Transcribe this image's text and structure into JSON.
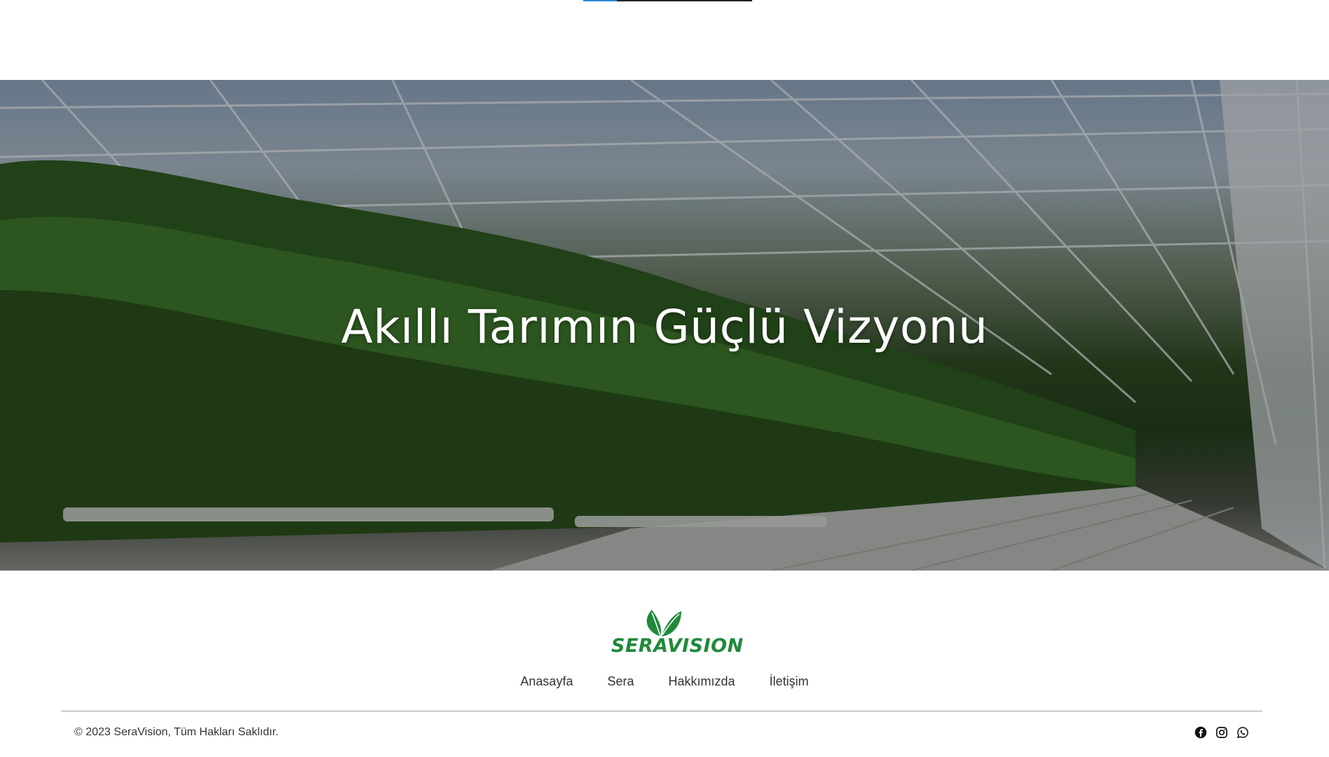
{
  "hero": {
    "title": "Akıllı Tarımın Güçlü Vizyonu"
  },
  "logo": {
    "text": "SERAVISION",
    "icon": "leaf-icon",
    "color": "#1f8a3a"
  },
  "footer": {
    "nav": [
      {
        "label": "Anasayfa"
      },
      {
        "label": "Sera"
      },
      {
        "label": "Hakkımızda"
      },
      {
        "label": "İletişim"
      }
    ],
    "copyright": "© 2023 SeraVision, Tüm Hakları Saklıdır.",
    "social": [
      {
        "icon": "facebook-icon"
      },
      {
        "icon": "instagram-icon"
      },
      {
        "icon": "whatsapp-icon"
      }
    ]
  },
  "colors": {
    "accent": "#2b8bd8",
    "text": "#333333"
  }
}
